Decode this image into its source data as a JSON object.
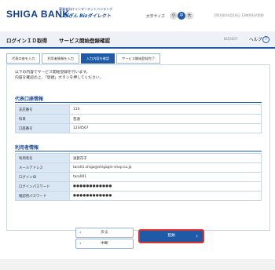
{
  "header": {
    "brand": "SHIGA BANK",
    "tagline_line1": "事業者向けインターネットバンキング",
    "service_name": "しがぎん Bizダイレクト",
    "font_size_label": "文字サイズ",
    "font_size_options": [
      "小",
      "中",
      "大"
    ],
    "datetime": "2016年04月18日 13時00分00秒"
  },
  "titlebar": {
    "page_title": "ログインＩＤ取得",
    "page_subtitle": "サービス開始登録確認",
    "screen_id": "BIZ0007",
    "help_label": "ヘルプ",
    "help_icon": "?"
  },
  "steps": [
    "代表口座を入力",
    "利用者情報を入力",
    "入力内容を確認",
    "サービス開始登録完了"
  ],
  "intro": {
    "line1": "以下の内容でサービス開始登録を行います。",
    "line2": "内容を確認の上、「登録」ボタンを押してください。"
  },
  "account_section": {
    "title": "代表口座情報",
    "rows": [
      {
        "label": "支店番号",
        "value": "110"
      },
      {
        "label": "科目",
        "value": "普通"
      },
      {
        "label": "口座番号",
        "value": "1234567"
      }
    ]
  },
  "user_section": {
    "title": "利用者情報",
    "rows": [
      {
        "label": "利用者名",
        "value": "滋賀花子"
      },
      {
        "label": "メールアドレス",
        "value": "taro01.shiga@shigagin-shop.co.jp"
      },
      {
        "label": "ログインID",
        "value": "taro001"
      },
      {
        "label": "ログインパスワード",
        "value": "●●●●●●●●●●●●"
      },
      {
        "label": "確認用パスワード",
        "value": "●●●●●●●●●●●●"
      }
    ]
  },
  "buttons": {
    "back": "戻る",
    "cancel": "中断",
    "register": "登録"
  },
  "colors": {
    "brand_blue": "#1f5aa6",
    "highlight_red": "#e0312f",
    "label_bg": "#d9e6f4"
  }
}
